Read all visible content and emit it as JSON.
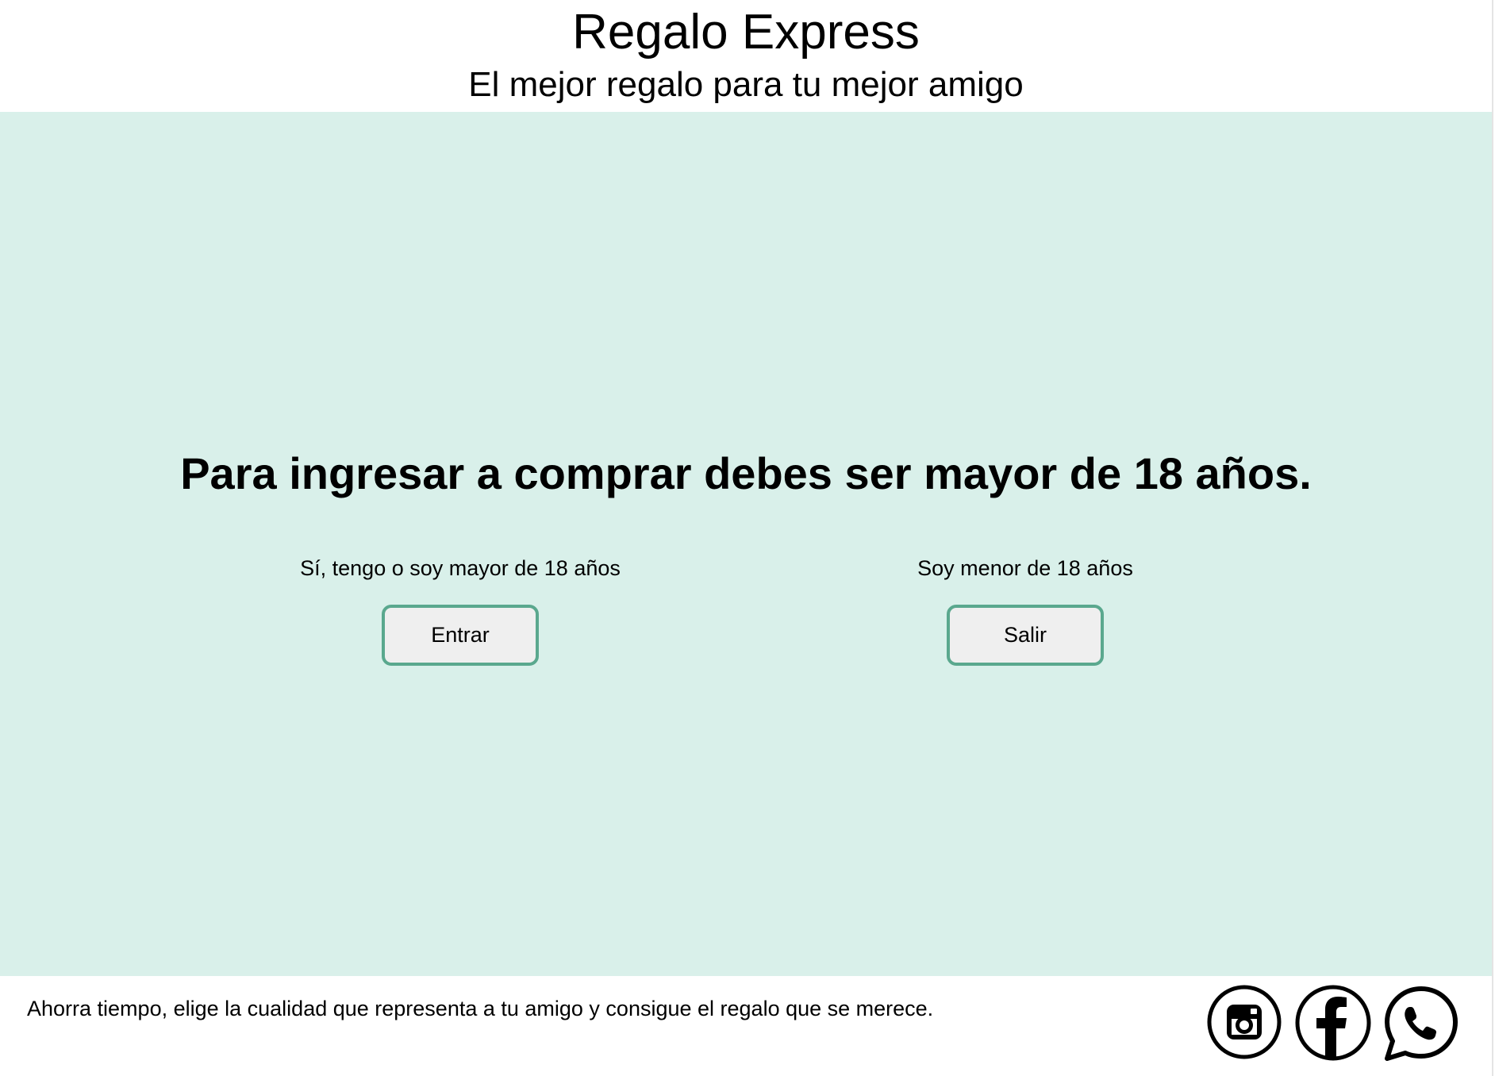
{
  "header": {
    "title": "Regalo Express",
    "tagline": "El mejor regalo para tu mejor amigo"
  },
  "main": {
    "heading": "Para ingresar a comprar debes ser mayor de 18 años.",
    "options": [
      {
        "label": "Sí, tengo o soy mayor de 18 años",
        "button": "Entrar"
      },
      {
        "label": "Soy menor de 18 años",
        "button": "Salir"
      }
    ]
  },
  "footer": {
    "text": "Ahorra tiempo, elige la cualidad que representa a tu amigo y consigue el regalo que se merece.",
    "social_icons": [
      "instagram-icon",
      "facebook-icon",
      "whatsapp-icon"
    ]
  },
  "colors": {
    "main_background": "#d9f0ea",
    "button_border": "#5aa88e",
    "button_background": "#efefef"
  }
}
